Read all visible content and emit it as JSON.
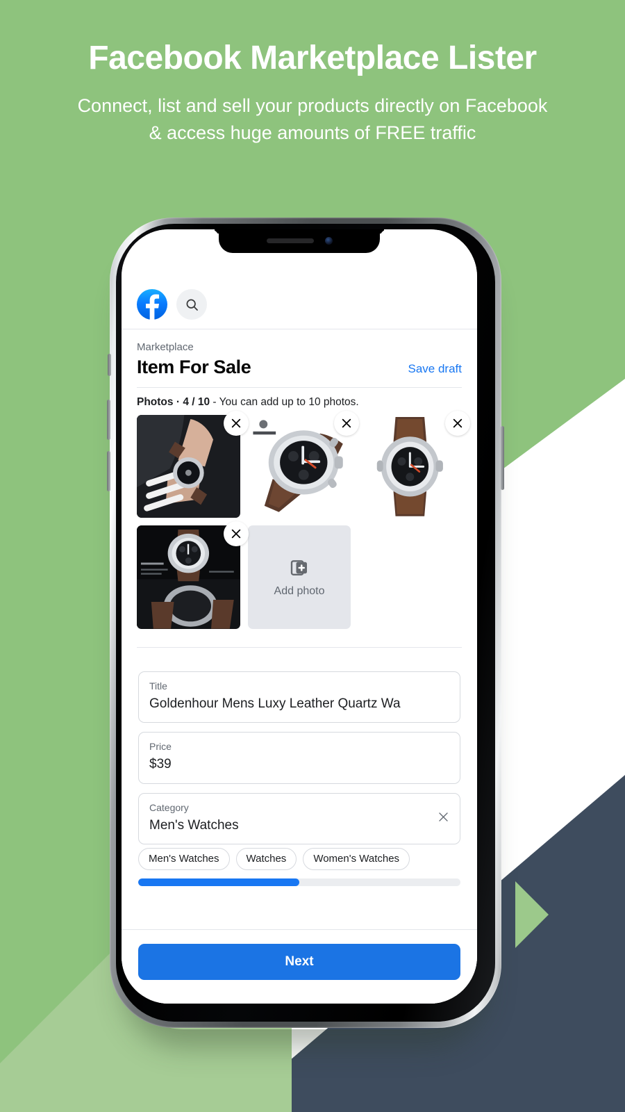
{
  "hero": {
    "title": "Facebook Marketplace Lister",
    "subtitle": "Connect, list and sell your products directly on Facebook & access huge amounts of FREE traffic"
  },
  "colors": {
    "background_green": "#8EC37D",
    "background_green_light": "#A6CC95",
    "background_navy": "#3E4C5E",
    "facebook_blue": "#1877F2",
    "next_button_blue": "#1B74E4",
    "white": "#FFFFFF"
  },
  "app": {
    "topbar": {
      "logo_alt": "Facebook",
      "search_alt": "Search"
    },
    "breadcrumb": "Marketplace",
    "page_title": "Item For Sale",
    "save_draft_label": "Save draft",
    "photos": {
      "label_prefix": "Photos",
      "separator": "·",
      "count": "4 / 10",
      "hint": "- You can add up to 10 photos.",
      "full_label": "Photos · 4 / 10 - You can add up to 10 photos.",
      "current": 4,
      "max": 10,
      "add_photo_label": "Add photo",
      "remove_label": "Remove photo",
      "items": [
        {
          "alt": "Man wearing chronograph watch on wrist",
          "style": "dark"
        },
        {
          "alt": "Silver chronograph watch with brown leather strap",
          "style": "white"
        },
        {
          "alt": "Silver chronograph watch front view brown strap",
          "style": "white"
        },
        {
          "alt": "Watch product detail on black background",
          "style": "dark"
        }
      ]
    },
    "fields": [
      {
        "label": "Title",
        "value": "Goldenhour Mens Luxy Leather Quartz Wa",
        "clearable": false
      },
      {
        "label": "Price",
        "value": "$39",
        "clearable": false
      },
      {
        "label": "Category",
        "value": "Men's Watches",
        "clearable": true
      }
    ],
    "category_suggestions": [
      "Men's Watches",
      "Watches",
      "Women's Watches"
    ],
    "progress": {
      "percent": 50,
      "label": "Step progress"
    },
    "next_button_label": "Next"
  }
}
